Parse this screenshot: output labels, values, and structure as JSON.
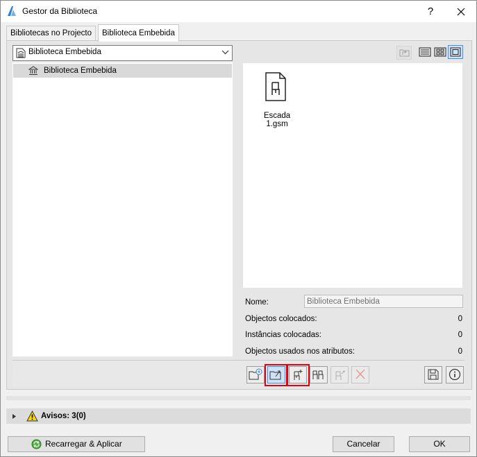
{
  "window": {
    "title": "Gestor da Biblioteca",
    "help_label": "?",
    "close_label": "✕"
  },
  "tabs": [
    {
      "label": "Bibliotecas no Projecto"
    },
    {
      "label": "Biblioteca Embebida"
    }
  ],
  "dropdown": {
    "selected": "Biblioteca Embebida"
  },
  "tree": {
    "items": [
      {
        "label": "Biblioteca Embebida"
      }
    ]
  },
  "preview": {
    "items": [
      {
        "label": "Escada 1.gsm"
      }
    ]
  },
  "info": {
    "name_label": "Nome:",
    "name_value": "Biblioteca Embebida",
    "placed_objects_label": "Objectos colocados:",
    "placed_objects_value": "0",
    "placed_instances_label": "Instâncias colocadas:",
    "placed_instances_value": "0",
    "attr_objects_label": "Objectos usados nos atributos:",
    "attr_objects_value": "0"
  },
  "warnings": {
    "label": "Avisos: 3(0)"
  },
  "footer": {
    "reload_label": "Recarregar & Aplicar",
    "cancel_label": "Cancelar",
    "ok_label": "OK"
  },
  "colors": {
    "highlight": "#e3000f",
    "selection": "#d9d9d9",
    "accent": "#2d7fd3"
  }
}
